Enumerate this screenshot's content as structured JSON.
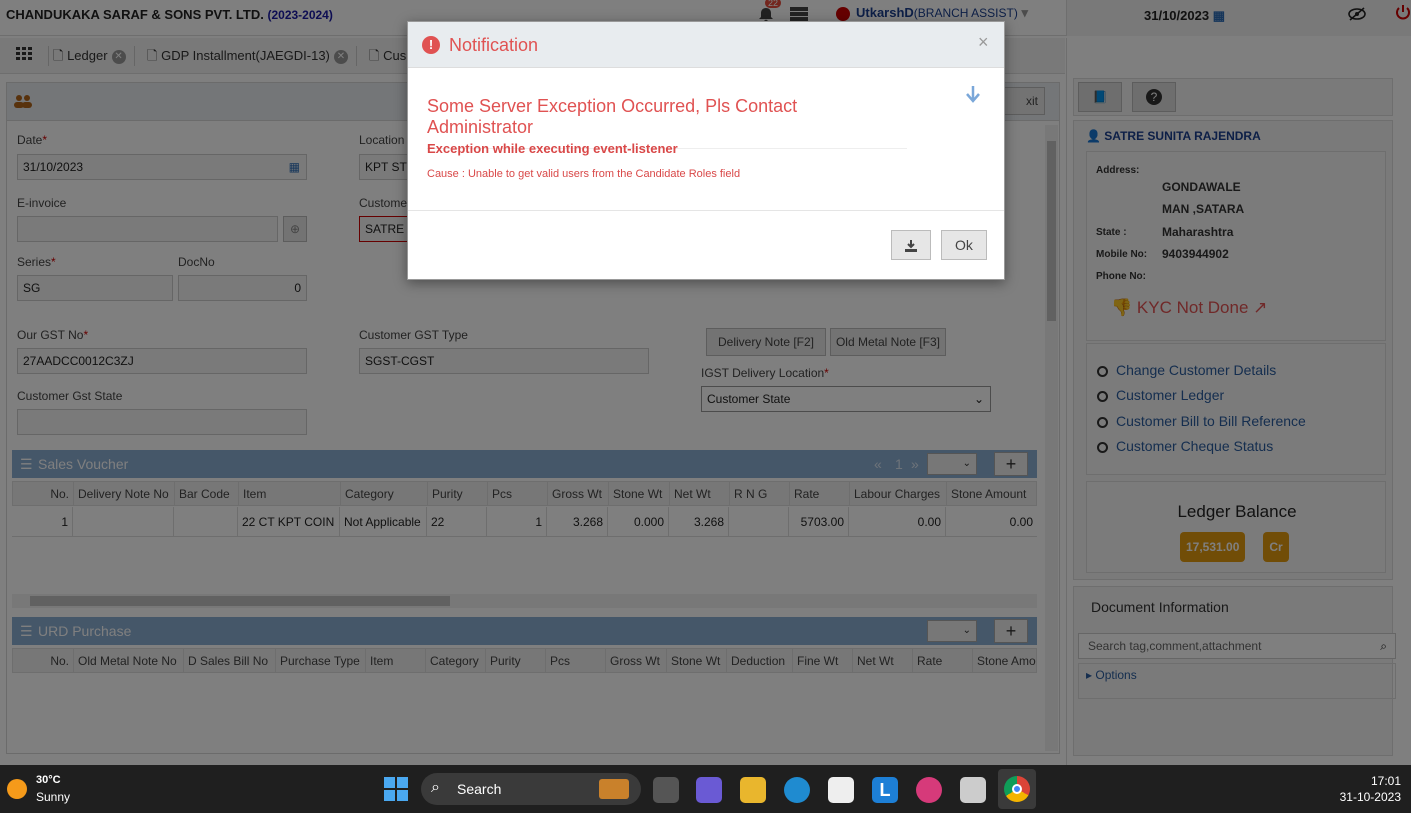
{
  "header": {
    "company": "CHANDUKAKA SARAF & SONS PVT. LTD.",
    "year": "(2023-2024)",
    "notif_count": "22",
    "user": "UtkarshD",
    "role": "(BRANCH ASSIST)",
    "date": "31/10/2023"
  },
  "tabs": [
    {
      "label": "Ledger"
    },
    {
      "label": "GDP Installment(JAEGDI-13)"
    },
    {
      "label": "Cus"
    }
  ],
  "form": {
    "date_label": "Date",
    "date_value": "31/10/2023",
    "location_label": "Location",
    "location_value": "KPT ST",
    "einvoice_label": "E-invoice",
    "customer_label": "Custome",
    "customer_value": "SATRE",
    "series_label": "Series",
    "series_value": "SG",
    "docno_label": "DocNo",
    "docno_value": "0",
    "gst_label": "Our GST No",
    "gst_value": "27AADCC0012C3ZJ",
    "cust_gst_type_label": "Customer GST Type",
    "cust_gst_type_value": "SGST-CGST",
    "cust_gst_state_label": "Customer Gst State",
    "delivery_note_btn": "Delivery Note [F2]",
    "old_metal_btn": "Old Metal Note [F3]",
    "igst_label": "IGST Delivery Location",
    "igst_value": "Customer State",
    "exit_label": "xit"
  },
  "sales": {
    "title": "Sales Voucher",
    "page_prev": "«",
    "page_num": "1",
    "page_next": "»",
    "columns": [
      "No.",
      "Delivery Note No",
      "Bar Code",
      "Item",
      "Category",
      "Purity",
      "Pcs",
      "Gross Wt",
      "Stone Wt",
      "Net Wt",
      "R N G",
      "Rate",
      "Labour Charges",
      "Stone Amount"
    ],
    "row": [
      "1",
      "",
      "",
      "22 CT KPT COIN",
      "Not Applicable",
      "22",
      "1",
      "3.268",
      "0.000",
      "3.268",
      "",
      "5703.00",
      "0.00",
      "0.00"
    ]
  },
  "urd": {
    "title": "URD Purchase",
    "columns": [
      "No.",
      "Old Metal Note No",
      "D Sales Bill No",
      "Purchase Type",
      "Item",
      "Category",
      "Purity",
      "Pcs",
      "Gross Wt",
      "Stone Wt",
      "Deduction",
      "Fine Wt",
      "Net Wt",
      "Rate",
      "Stone Amo"
    ]
  },
  "customer": {
    "name": "SATRE SUNITA RAJENDRA",
    "address_label": "Address:",
    "address_line1": "GONDAWALE",
    "address_line2": "MAN ,SATARA",
    "state_label": "State :",
    "state_value": "Maharashtra",
    "mobile_label": "Mobile No:",
    "mobile_value": "9403944902",
    "phone_label": "Phone No:",
    "kyc": "KYC Not Done",
    "links": [
      "Change Customer Details",
      "Customer Ledger",
      "Customer Bill to Bill Reference",
      "Customer Cheque Status"
    ],
    "ledger_title": "Ledger Balance",
    "ledger_amount": "17,531.00",
    "ledger_type": "Cr",
    "doc_title": "Document Information",
    "doc_search_placeholder": "Search tag,comment,attachment",
    "options": "Options"
  },
  "modal": {
    "title": "Notification",
    "heading": "Some Server Exception Occurred, Pls Contact Administrator",
    "error": "Exception while executing event-listener",
    "cause": "Cause : Unable to get valid users from the Candidate Roles field",
    "ok": "Ok"
  },
  "taskbar": {
    "temp": "30°C",
    "weather": "Sunny",
    "search": "Search",
    "time": "17:01",
    "date": "31-10-2023"
  },
  "colors": {
    "accent": "#8aaed3",
    "error": "#e05252",
    "ledger_badge": "#e29a0e"
  }
}
